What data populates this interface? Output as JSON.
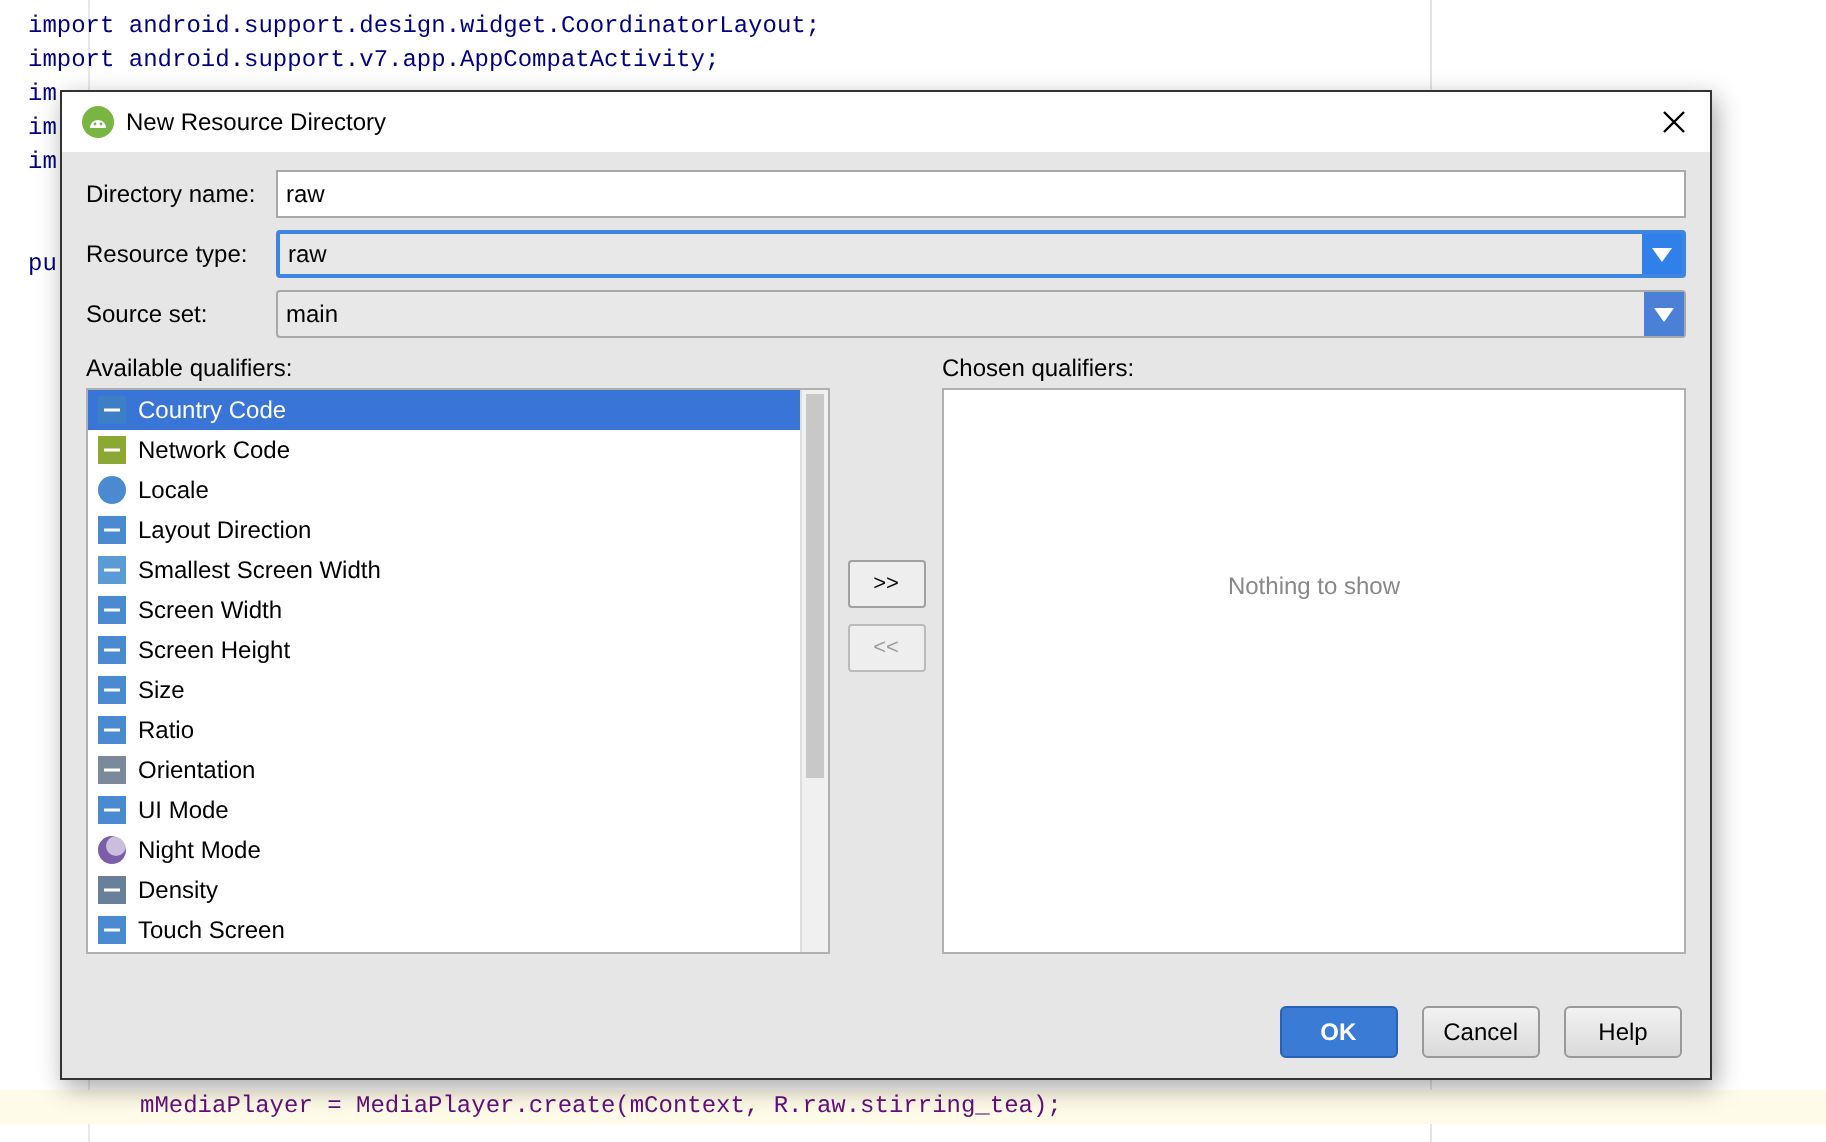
{
  "editor": {
    "top_lines": [
      "import android.support.design.widget.CoordinatorLayout;",
      "import android.support.v7.app.AppCompatActivity;",
      "im",
      "im",
      "im"
    ],
    "lower_lines": [
      "pu"
    ],
    "bottom_line": "mMediaPlayer = MediaPlayer.create(mContext, R.raw.stirring_tea);"
  },
  "dialog": {
    "title": "New Resource Directory",
    "fields": [
      {
        "kind": "text",
        "label": "Directory name:",
        "value": "raw"
      },
      {
        "kind": "combo",
        "label": "Resource type:",
        "value": "raw",
        "focused": true
      },
      {
        "kind": "combo",
        "label": "Source set:",
        "value": "main",
        "focused": false
      }
    ],
    "available": {
      "label": "Available qualifiers:",
      "items": [
        {
          "label": "Country Code",
          "selected": true
        },
        {
          "label": "Network Code",
          "selected": false
        },
        {
          "label": "Locale",
          "selected": false
        },
        {
          "label": "Layout Direction",
          "selected": false
        },
        {
          "label": "Smallest Screen Width",
          "selected": false
        },
        {
          "label": "Screen Width",
          "selected": false
        },
        {
          "label": "Screen Height",
          "selected": false
        },
        {
          "label": "Size",
          "selected": false
        },
        {
          "label": "Ratio",
          "selected": false
        },
        {
          "label": "Orientation",
          "selected": false
        },
        {
          "label": "UI Mode",
          "selected": false
        },
        {
          "label": "Night Mode",
          "selected": false
        },
        {
          "label": "Density",
          "selected": false
        },
        {
          "label": "Touch Screen",
          "selected": false
        }
      ]
    },
    "move_buttons": [
      {
        "label": ">>",
        "disabled": false
      },
      {
        "label": "<<",
        "disabled": true
      }
    ],
    "chosen": {
      "label": "Chosen qualifiers:",
      "placeholder": "Nothing to show"
    },
    "buttons": [
      {
        "label": "OK",
        "default": true
      },
      {
        "label": "Cancel",
        "default": false
      },
      {
        "label": "Help",
        "default": false
      }
    ]
  }
}
